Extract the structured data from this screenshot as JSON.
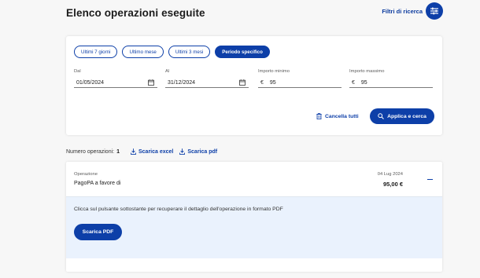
{
  "header": {
    "title": "Elenco operazioni eseguite",
    "filters_label": "Filtri di ricerca",
    "filters_icon": "sliders-icon"
  },
  "filters": {
    "chips": [
      {
        "label": "Ultimi 7 giorni",
        "active": false
      },
      {
        "label": "Ultimo mese",
        "active": false
      },
      {
        "label": "Ultimi 3 mesi",
        "active": false
      },
      {
        "label": "Periodo specifico",
        "active": true
      }
    ],
    "from": {
      "label": "Dal",
      "value": "01/05/2024"
    },
    "to": {
      "label": "Al",
      "value": "31/12/2024"
    },
    "min_amount": {
      "label": "Importo minimo",
      "currency": "€",
      "value": "95"
    },
    "max_amount": {
      "label": "Importo massimo",
      "currency": "€",
      "value": "95"
    },
    "clear_label": "Cancella tutti",
    "apply_label": "Applica e cerca"
  },
  "summary": {
    "count_label": "Numero operazioni:",
    "count": "1",
    "excel_label": "Scarica excel",
    "pdf_label": "Scarica pdf"
  },
  "operation": {
    "kind_label": "Operazione",
    "description": "PagoPA a favore di",
    "date": "04 Lug 2024",
    "amount": "95,00 €",
    "detail_text": "Clicca sul pulsante sottostante per recuperare il dettaglio dell'operazione in formato PDF",
    "pdf_button_label": "Scarica PDF"
  },
  "colors": {
    "primary": "#0d3fa8",
    "detail_bg": "#eaf2fd",
    "page_bg": "#f7f7f7"
  }
}
